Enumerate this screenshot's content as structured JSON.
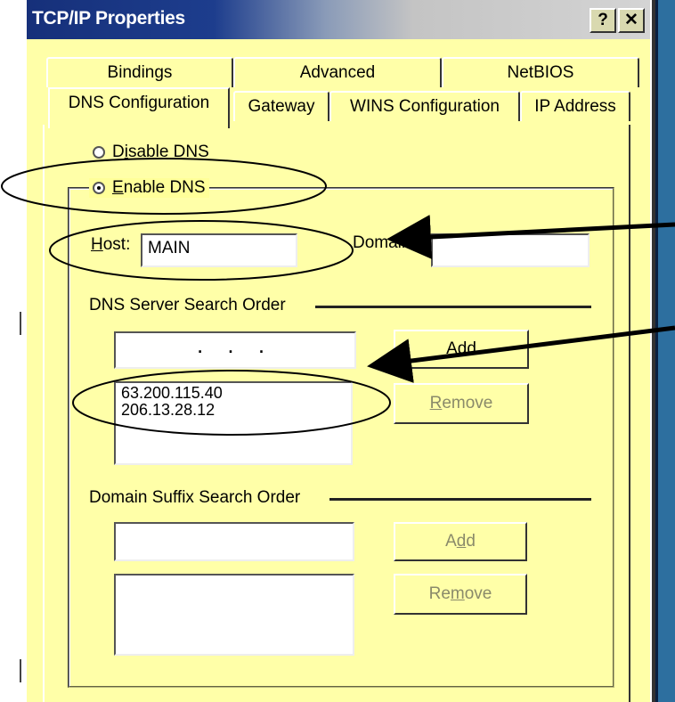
{
  "window": {
    "title": "TCP/IP Properties",
    "help_button": "?",
    "close_button": "✕"
  },
  "tabs": {
    "back_row": [
      "Bindings",
      "Advanced",
      "NetBIOS"
    ],
    "front_row": [
      "DNS Configuration",
      "Gateway",
      "WINS Configuration",
      "IP Address"
    ],
    "active": "DNS Configuration"
  },
  "dns": {
    "disable_pre": "D",
    "disable_accel": "i",
    "disable_post": "sable DNS",
    "enable_accel": "E",
    "enable_post": "nable DNS",
    "selected": "Enable DNS",
    "host_accel": "H",
    "host_post": "ost:",
    "host_value": "MAIN",
    "domain_label": "Domain:",
    "domain_value": ""
  },
  "dns_server_search_order": {
    "heading": "DNS Server Search Order",
    "ip_input": ". . .",
    "add_label": "Add",
    "remove_accel": "R",
    "remove_post": "emove",
    "servers": [
      "63.200.115.40",
      "206.13.28.12"
    ]
  },
  "domain_suffix_search_order": {
    "heading": "Domain Suffix Search Order",
    "suffix_input": "",
    "add_pre": "A",
    "add_accel": "d",
    "add_post": "d",
    "remove_pre": "Re",
    "remove_accel": "m",
    "remove_post": "ove",
    "suffixes": []
  },
  "annotations": {
    "ellipse_color": "#000000",
    "arrow_color": "#000000"
  }
}
